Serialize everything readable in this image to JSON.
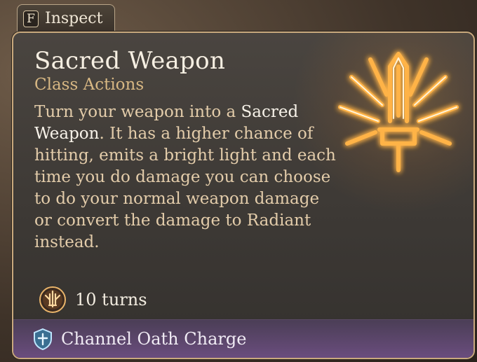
{
  "inspect": {
    "key": "F",
    "label": "Inspect"
  },
  "tooltip": {
    "title": "Sacred Weapon",
    "category": "Class Actions",
    "description_parts": {
      "p1": "Turn your weapon into a ",
      "highlight": "Sacred Weapon",
      "p2": ". It has a higher chance of hitting, emits a bright light and each time you do damage you can choose to do your normal weapon damage or convert the damage to Radiant instead."
    },
    "duration": "10 turns",
    "cost": "Channel Oath Charge"
  },
  "icons": {
    "spell": "sacred-weapon-sigil-icon",
    "duration": "duration-turns-icon",
    "cost": "channel-oath-icon"
  },
  "colors": {
    "accent_gold": "#d7b783",
    "glow": "#ffb347",
    "footer_purple": "#6a4d7e",
    "oath_blue": "#8fd3ff"
  }
}
